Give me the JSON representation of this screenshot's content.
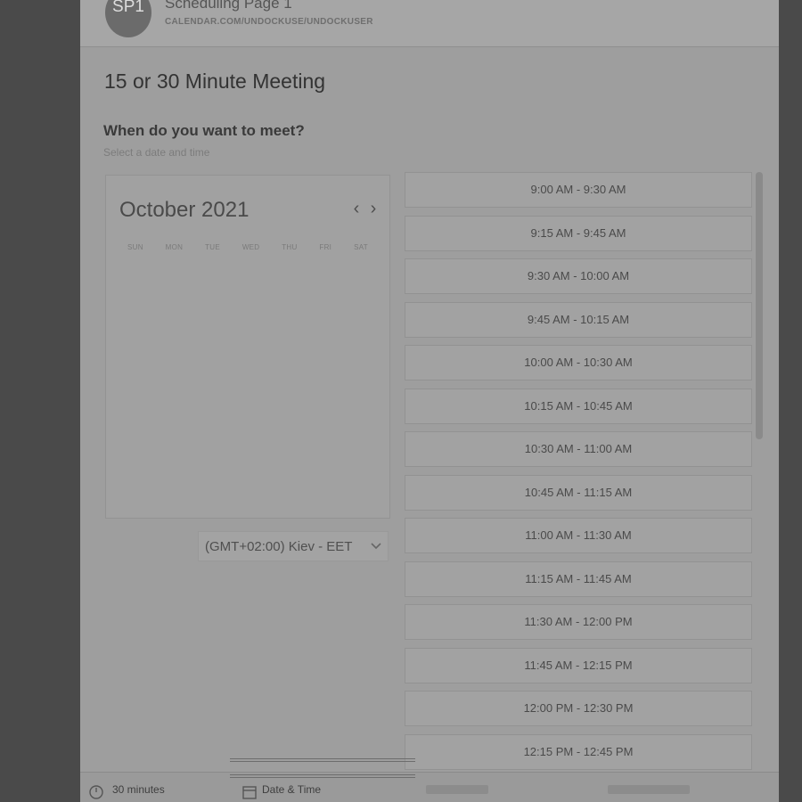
{
  "header": {
    "avatar_initials": "SP1",
    "page_name": "Scheduling Page 1",
    "url": "CALENDAR.COM/UNDOCKUSE/UNDOCKUSER"
  },
  "meeting": {
    "title": "15 or 30 Minute Meeting",
    "question": "When do you want to meet?",
    "instruction": "Select a date and time"
  },
  "calendar": {
    "month_label": "October 2021",
    "prev_icon": "chevron-left-icon",
    "next_icon": "chevron-right-icon",
    "weekdays": [
      "SUN",
      "MON",
      "TUE",
      "WED",
      "THU",
      "FRI",
      "SAT"
    ]
  },
  "timezone": {
    "label": "(GMT+02:00) Kiev - EET",
    "icon": "chevron-down-icon"
  },
  "slots": [
    "9:00 AM - 9:30 AM",
    "9:15 AM - 9:45 AM",
    "9:30 AM - 10:00 AM",
    "9:45 AM - 10:15 AM",
    "10:00 AM - 10:30 AM",
    "10:15 AM - 10:45 AM",
    "10:30 AM - 11:00 AM",
    "10:45 AM - 11:15 AM",
    "11:00 AM - 11:30 AM",
    "11:15 AM - 11:45 AM",
    "11:30 AM - 12:00 PM",
    "11:45 AM - 12:15 PM",
    "12:00 PM - 12:30 PM",
    "12:15 PM - 12:45 PM"
  ],
  "footer": {
    "duration_label": "30 minutes",
    "datetime_label": "Date & Time",
    "duration_icon": "clock-icon",
    "datetime_icon": "calendar-icon"
  },
  "colors": {
    "overlay": "#4a4a4a",
    "panel": "#9e9e9e"
  }
}
